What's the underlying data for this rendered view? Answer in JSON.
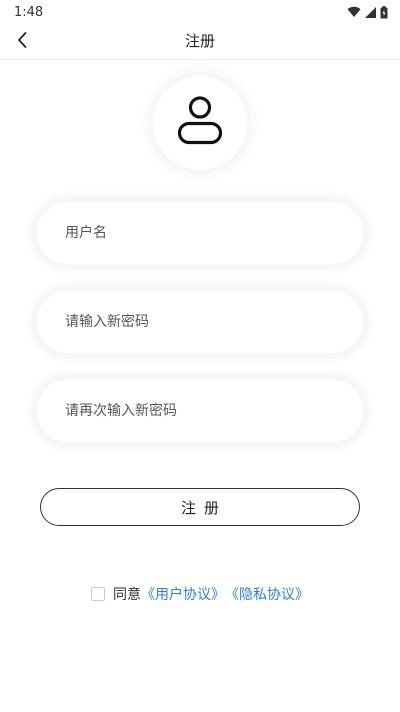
{
  "status_bar": {
    "time": "1:48",
    "icons": [
      "wifi-icon",
      "signal-icon",
      "battery-icon"
    ]
  },
  "app_bar": {
    "title": "注册",
    "back_icon": "chevron-left-icon"
  },
  "avatar": {
    "icon": "person-icon"
  },
  "form": {
    "username_placeholder": "用户名",
    "password_placeholder": "请输入新密码",
    "confirm_placeholder": "请再次输入新密码",
    "submit_label": "注册"
  },
  "agreement": {
    "checked": false,
    "prefix": "同意",
    "user_agreement": "《用户协议》",
    "privacy_policy": "《隐私协议》"
  },
  "colors": {
    "link": "#2f7fe0",
    "button_border": "#333333",
    "background": "#ffffff"
  }
}
